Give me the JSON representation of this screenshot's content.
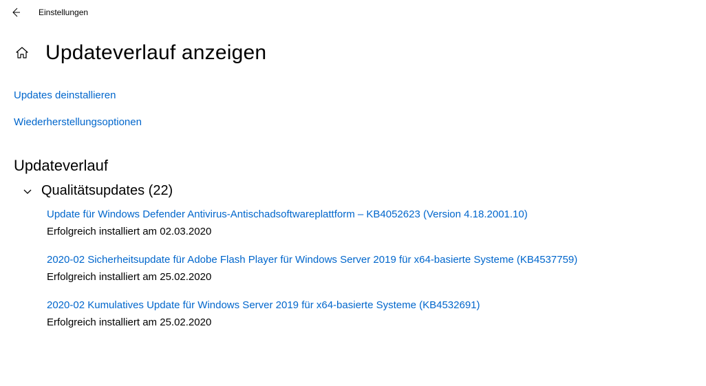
{
  "topbar": {
    "app_title": "Einstellungen"
  },
  "page": {
    "title": "Updateverlauf anzeigen"
  },
  "links": {
    "uninstall": "Updates deinstallieren",
    "recovery": "Wiederherstellungsoptionen"
  },
  "section": {
    "heading": "Updateverlauf",
    "category_label": "Qualitätsupdates (22)"
  },
  "updates": [
    {
      "title": "Update für Windows Defender Antivirus-Antischadsoftwareplattform – KB4052623 (Version 4.18.2001.10)",
      "status": "Erfolgreich installiert am 02.03.2020"
    },
    {
      "title": "2020-02 Sicherheitsupdate für Adobe Flash Player für Windows Server 2019 für x64-basierte Systeme (KB4537759)",
      "status": "Erfolgreich installiert am 25.02.2020"
    },
    {
      "title": "2020-02 Kumulatives Update für Windows Server 2019 für x64-basierte Systeme (KB4532691)",
      "status": "Erfolgreich installiert am 25.02.2020"
    }
  ],
  "colors": {
    "link": "#0066cc"
  }
}
